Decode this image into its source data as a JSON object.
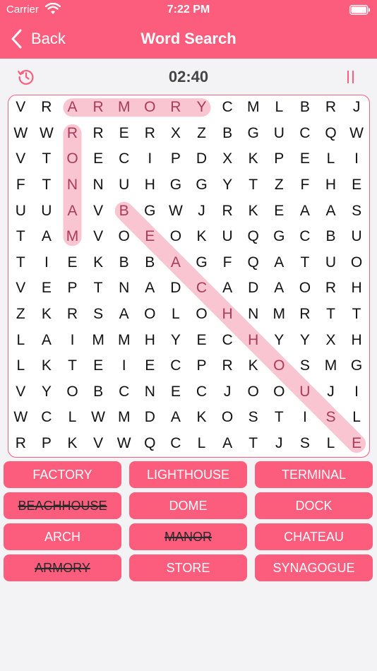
{
  "status": {
    "carrier": "Carrier",
    "time": "7:22 PM"
  },
  "nav": {
    "back_label": "Back",
    "title": "Word Search"
  },
  "game": {
    "timer": "02:40"
  },
  "colors": {
    "accent": "#fc5d7d",
    "highlight": "#f7b6c4",
    "found_letter": "#a83c58"
  },
  "grid": [
    "VRARMORYCMLBRJ",
    "WWRRERXZBGUCQW",
    "VTOECIPDXKPELI",
    "FTNNUHGGYTZFHE",
    "UUAVBGWJRKEAAS",
    "TAMVOEOKUQGCBU",
    "TIEKBBAGFQATUO",
    "VEPTNADCADAORH",
    "ZKRSAOLOHNMRTT",
    "LAIMMHYECHYYXH",
    "LKTEIECPRKOSMG",
    "VYOBCNECJOOUJI",
    "WCLWMDAKOSTISL",
    "RPKVWQCLATJSLE"
  ],
  "found": [
    {
      "word": "ARMORY",
      "from": [
        0,
        2
      ],
      "to": [
        0,
        7
      ]
    },
    {
      "word": "MANOR",
      "from": [
        5,
        2
      ],
      "to": [
        1,
        2
      ]
    },
    {
      "word": "BEACHHOUSE",
      "from": [
        4,
        4
      ],
      "to": [
        13,
        13
      ]
    }
  ],
  "words": [
    {
      "label": "FACTORY",
      "found": false
    },
    {
      "label": "LIGHTHOUSE",
      "found": false
    },
    {
      "label": "TERMINAL",
      "found": false
    },
    {
      "label": "BEACHHOUSE",
      "found": true
    },
    {
      "label": "DOME",
      "found": false
    },
    {
      "label": "DOCK",
      "found": false
    },
    {
      "label": "ARCH",
      "found": false
    },
    {
      "label": "MANOR",
      "found": true
    },
    {
      "label": "CHATEAU",
      "found": false
    },
    {
      "label": "ARMORY",
      "found": true
    },
    {
      "label": "STORE",
      "found": false
    },
    {
      "label": "SYNAGOGUE",
      "found": false
    }
  ]
}
